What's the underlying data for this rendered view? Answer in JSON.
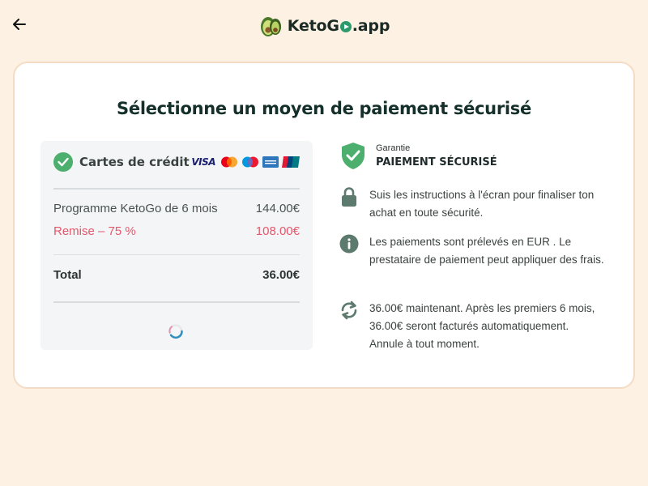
{
  "header": {
    "back_icon": "arrow-left-icon",
    "logo_icon": "avocado-icon",
    "logo_text_prefix": "KetoG",
    "logo_text_suffix": ".app"
  },
  "main": {
    "title": "Sélectionne un moyen de paiement sécurisé",
    "payment": {
      "method_label": "Cartes de crédit",
      "selected": true,
      "card_brands": [
        "VISA",
        "Mastercard",
        "Maestro",
        "American Express",
        "UnionPay"
      ],
      "visa_label": "VISA",
      "line_item_label": "Programme KetoGo de 6 mois",
      "line_item_price": "144.00€",
      "discount_label": "Remise –  75 %",
      "discount_amount": "108.00€",
      "total_label": "Total",
      "total_amount": "36.00€",
      "loading": true
    },
    "info": {
      "guarantee_small": "Garantie",
      "guarantee_big": "PAIEMENT SÉCURISÉ",
      "items": [
        {
          "icon": "lock-icon",
          "text": "Suis les instructions à l'écran pour finaliser ton achat en toute sécurité."
        },
        {
          "icon": "info-icon",
          "text": "Les paiements sont prélevés en EUR . Le prestataire de paiement peut appliquer des frais."
        },
        {
          "icon": "refresh-icon",
          "text": "36.00€ maintenant. Après les premiers 6 mois, 36.00€ seront facturés automatiquement. Annule à tout moment."
        }
      ]
    }
  },
  "colors": {
    "background": "#fdf1e4",
    "card_border": "#f4dcc4",
    "accent_green": "#4caf6e",
    "discount_red": "#e4576b",
    "icon_gray_green": "#5d7a6e"
  }
}
